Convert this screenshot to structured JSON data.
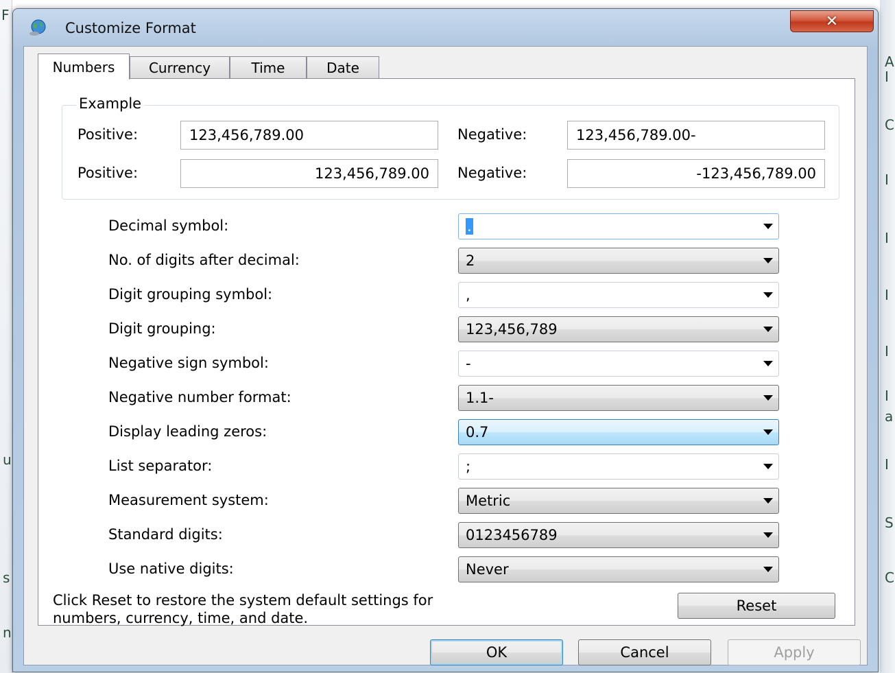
{
  "background": {
    "glyphs": [
      "F",
      "A",
      "I",
      "C",
      "I",
      "I",
      "I",
      "I",
      "I",
      "a",
      "I",
      "S",
      "C",
      "s",
      "u",
      "n"
    ]
  },
  "window": {
    "title": "Customize Format",
    "close_label": "✕"
  },
  "tabs": [
    {
      "label": "Numbers",
      "active": true
    },
    {
      "label": "Currency",
      "active": false
    },
    {
      "label": "Time",
      "active": false
    },
    {
      "label": "Date",
      "active": false
    }
  ],
  "example": {
    "legend": "Example",
    "row1": {
      "positive_label": "Positive:",
      "positive_value": "123,456,789.00",
      "negative_label": "Negative:",
      "negative_value": "123,456,789.00-"
    },
    "row2": {
      "positive_label": "Positive:",
      "positive_value": "123,456,789.00",
      "negative_label": "Negative:",
      "negative_value": "-123,456,789.00"
    }
  },
  "settings": [
    {
      "label": "Decimal symbol:",
      "value": ".",
      "style": "editable",
      "focused": true
    },
    {
      "label": "No. of digits after decimal:",
      "value": "2",
      "style": "listonly"
    },
    {
      "label": "Digit grouping symbol:",
      "value": ",",
      "style": "editable"
    },
    {
      "label": "Digit grouping:",
      "value": "123,456,789",
      "style": "listonly"
    },
    {
      "label": "Negative sign symbol:",
      "value": "-",
      "style": "editable"
    },
    {
      "label": "Negative number format:",
      "value": "1.1-",
      "style": "listonly"
    },
    {
      "label": "Display leading zeros:",
      "value": "0.7",
      "style": "focused"
    },
    {
      "label": "List separator:",
      "value": ";",
      "style": "editable"
    },
    {
      "label": "Measurement system:",
      "value": "Metric",
      "style": "listonly"
    },
    {
      "label": "Standard digits:",
      "value": "0123456789",
      "style": "listonly"
    },
    {
      "label": "Use native digits:",
      "value": "Never",
      "style": "listonly"
    }
  ],
  "footer": {
    "reset_text_line1": "Click Reset to restore the system default settings for",
    "reset_text_line2": "numbers, currency, time, and date.",
    "reset_label": "Reset"
  },
  "buttons": {
    "ok": "OK",
    "cancel": "Cancel",
    "apply": "Apply"
  },
  "colors": {
    "selection": "#3399ff",
    "close": "#c7432a",
    "focus_border": "#3c7fb1"
  }
}
